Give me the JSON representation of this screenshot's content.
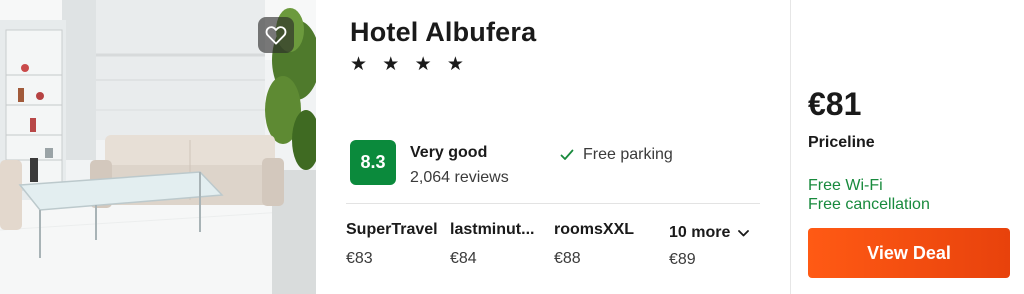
{
  "hotel": {
    "name": "Hotel Albufera",
    "stars": "★ ★ ★ ★"
  },
  "rating": {
    "score": "8.3",
    "label": "Very good",
    "reviews": "2,064 reviews"
  },
  "amenity": {
    "label": "Free parking",
    "icon": "check-icon",
    "color": "#188a3d"
  },
  "providers": [
    {
      "name": "SuperTravel",
      "price": "€83"
    },
    {
      "name": "lastminut...",
      "price": "€84"
    },
    {
      "name": "roomsXXL",
      "price": "€88"
    }
  ],
  "more": {
    "label": "10 more",
    "price": "€89",
    "icon": "chevron-down-icon"
  },
  "deal": {
    "price": "€81",
    "provider": "Priceline",
    "perks": [
      "Free Wi-Fi",
      "Free cancellation"
    ],
    "button_label": "View Deal",
    "button_color": "#ff5a14"
  },
  "photo": {
    "favorite_icon": "heart-icon"
  }
}
